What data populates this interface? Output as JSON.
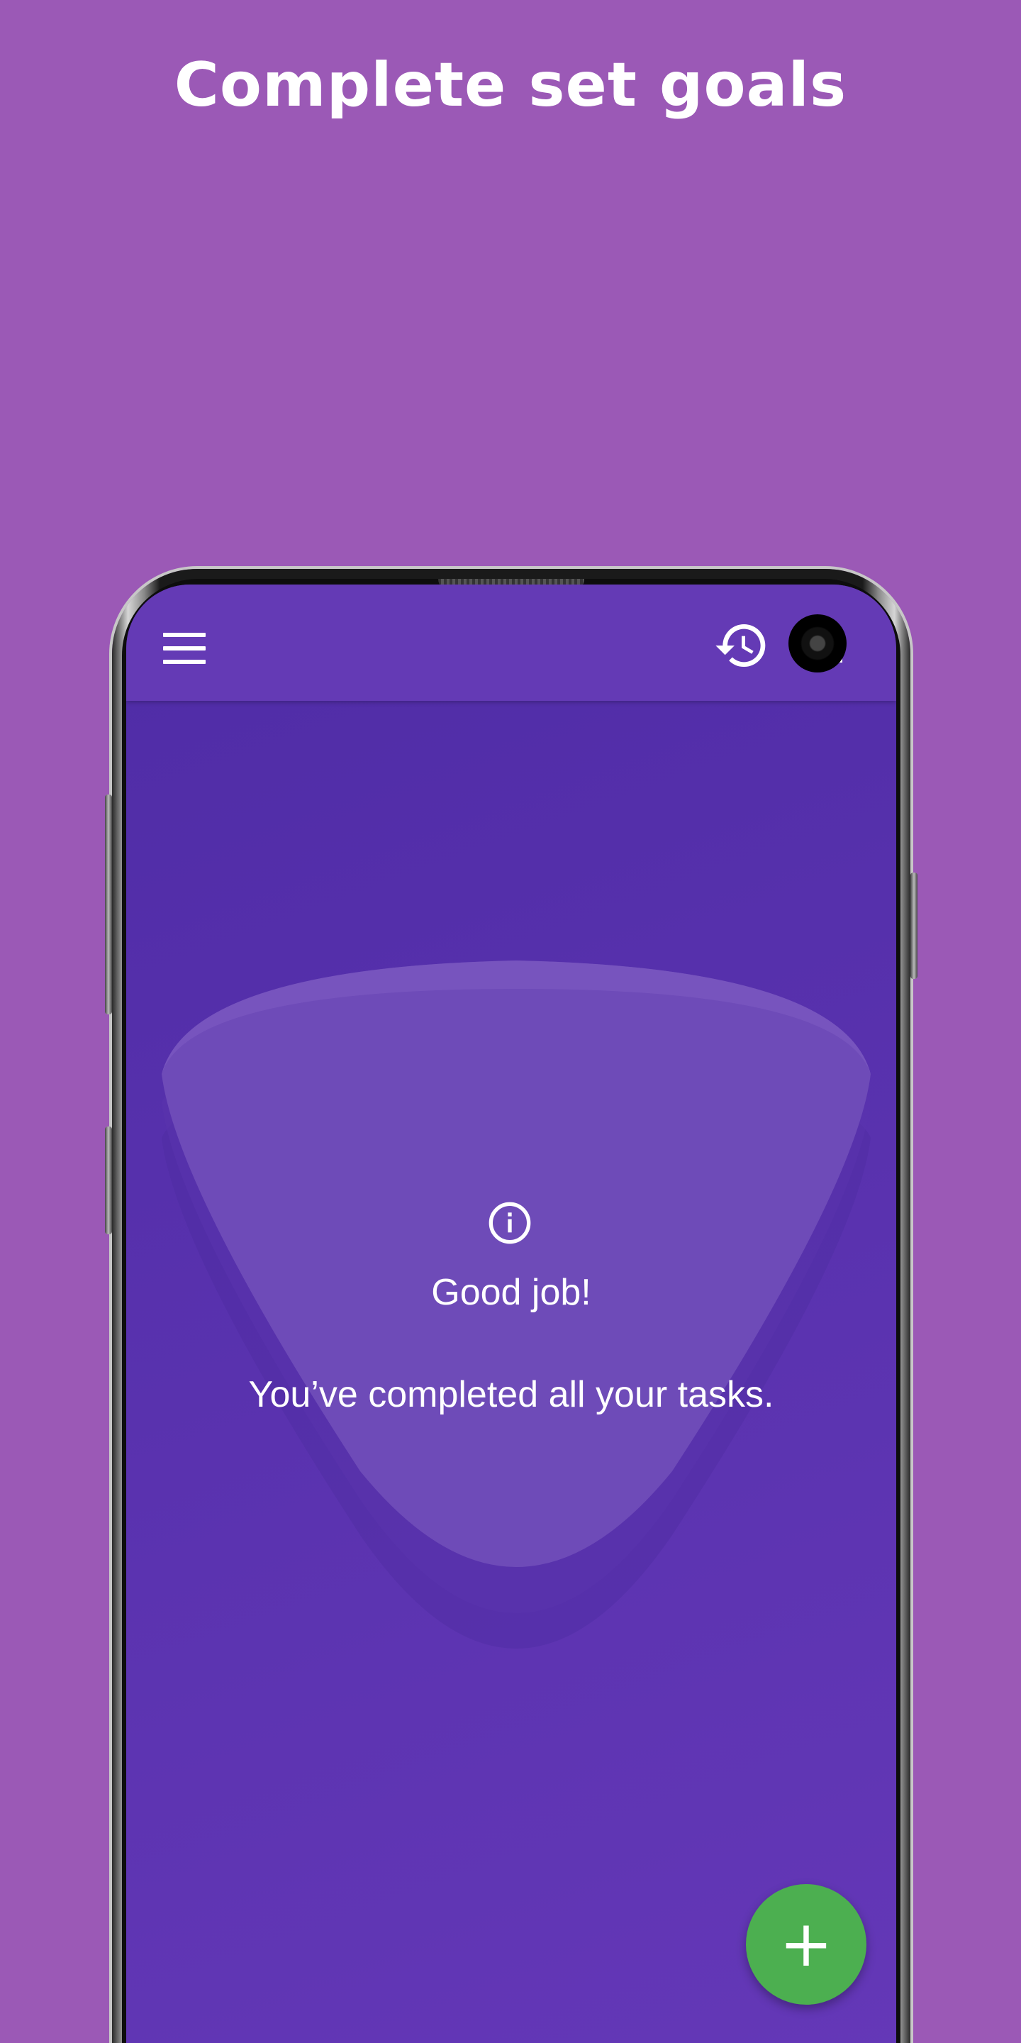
{
  "headline": "Complete set goals",
  "app": {
    "toolbar": {
      "menu_icon": "menu-icon",
      "history_icon": "history-icon",
      "stats_icon": "bar-chart-icon"
    },
    "empty_state": {
      "icon": "info-icon",
      "title": "Good job!",
      "message": "You’ve completed all your tasks."
    },
    "fab": {
      "icon": "plus-icon",
      "label": "+"
    }
  },
  "colors": {
    "background": "#9b59b6",
    "appbar": "#643ab5",
    "screen": "#5b33b0",
    "fab": "#4caf50"
  }
}
